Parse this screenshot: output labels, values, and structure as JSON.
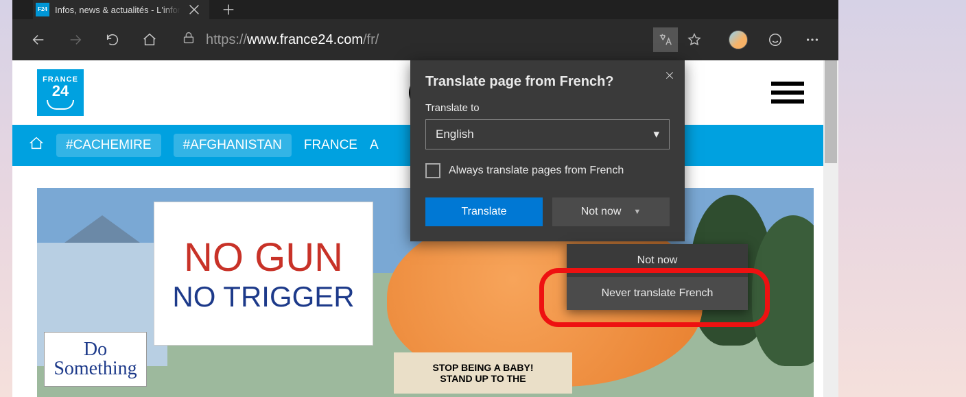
{
  "browser": {
    "tab_title": "Infos, news & actualités - L'infor",
    "url_proto": "https://",
    "url_domain": "www.france24.com",
    "url_path": "/fr/"
  },
  "site": {
    "logo_line1": "FRANCE",
    "logo_line2": "24",
    "nav": {
      "tag1": "#CACHEMIRE",
      "tag2": "#AFGHANISTAN",
      "item1": "FRANCE",
      "item2_partial": "A"
    },
    "hero": {
      "sign_line1": "NO GUN",
      "sign_line2": "NO TRIGGER",
      "do_something": "Do Something",
      "balloon_sign_l1": "STOP BEING A BABY!",
      "balloon_sign_l2": "STAND UP TO THE"
    }
  },
  "popup": {
    "title": "Translate page from French?",
    "translate_to_label": "Translate to",
    "selected_language": "English",
    "always_label": "Always translate pages from French",
    "translate_btn": "Translate",
    "not_now_btn": "Not now"
  },
  "menu": {
    "item1": "Not now",
    "item2": "Never translate French"
  }
}
